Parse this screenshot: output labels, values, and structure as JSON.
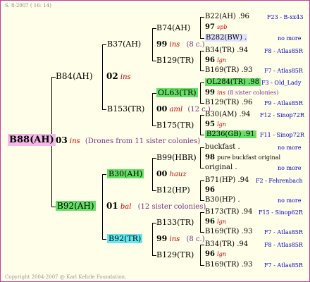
{
  "header": {
    "stamp": "S.  8-2007 ( 16: 14)"
  },
  "footer": {
    "copyright": "Copyright 2004-2007 @ Karl Kehrle Foundation."
  },
  "root": {
    "label": "B88(AH)",
    "num": "03",
    "mark": "ins",
    "note": "(Drones from 11 sister colonies)"
  },
  "gen1": [
    {
      "label": "B84(AH)",
      "num": "02",
      "mark": "ins",
      "note": ""
    },
    {
      "label": "B92(AH)",
      "num": "01",
      "mark": "bal",
      "note": "(12 sister colonies)"
    }
  ],
  "gen2": [
    {
      "label": "B37(AH)"
    },
    {
      "label": "B153(TR)"
    },
    {
      "label": "B30(AH)",
      "num": "00",
      "mark": "hauz"
    },
    {
      "label": "B92(TR)",
      "num": "99",
      "mark": "ins",
      "note": "(8 c.)"
    }
  ],
  "gen3": [
    {
      "label": "B74(AH)",
      "num": "99",
      "mark": "ins",
      "note": "(8 c.)"
    },
    {
      "label": "B129(TR)"
    },
    {
      "label": "OL63(TR)",
      "num": "00",
      "mark": "aml",
      "note": "(12 c.)"
    },
    {
      "label": "B175(TR)"
    },
    {
      "label": "B99(HBR)"
    },
    {
      "label": "B12(HP)"
    },
    {
      "label": "B133(TR)"
    },
    {
      "label": "B129(TR)"
    }
  ],
  "gen4": [
    {
      "top": "B22(AH) .96",
      "top_r": "F23 - B-xx43",
      "num": "97",
      "mark": "spb",
      "note": "",
      "bot": "B282(BW) .",
      "bot_r": "no more"
    },
    {
      "top": "B34(TR) .94",
      "top_r": "F8 - Atlas85R",
      "num": "96",
      "mark": "lgn",
      "note": "",
      "bot": "B169(TR) .93",
      "bot_r": "F7 - Atlas85R"
    },
    {
      "top": "OL284(TR) .98",
      "top_r": "F3 - Old_Lady",
      "num": "99",
      "mark": "ins",
      "note": "(8 sister colonies)",
      "bot": "B129(TR) .96",
      "bot_r": "F9 - Atlas85R"
    },
    {
      "top": "B30(AM) .94",
      "top_r": "F12 - Sinop72R",
      "num": "95",
      "mark": "lgn",
      "note": "",
      "bot": "B236(GB) .91",
      "bot_r": "F11 - Sinop72R"
    },
    {
      "top": "buckfast .",
      "top_r": "no more",
      "num": "98",
      "mark": "",
      "note": "pure buckfast original",
      "bot": "original .",
      "bot_r": "no more"
    },
    {
      "top": "B71(HP) .94",
      "top_r": "F2 - Fehrenbach",
      "num": "96",
      "mark": "",
      "note": "",
      "bot": "B30(HP) .",
      "bot_r": "no more"
    },
    {
      "top": "B173(TR) .94",
      "top_r": "F15 - Sinop62R",
      "num": "96",
      "mark": "lgn",
      "note": "",
      "bot": "B169(TR) .93",
      "bot_r": "F7 - Atlas85R"
    },
    {
      "top": "B34(TR) .94",
      "top_r": "F8 - Atlas85R",
      "num": "96",
      "mark": "lgn",
      "note": "",
      "bot": "B169(TR) .93",
      "bot_r": "F7 - Atlas85R"
    }
  ]
}
